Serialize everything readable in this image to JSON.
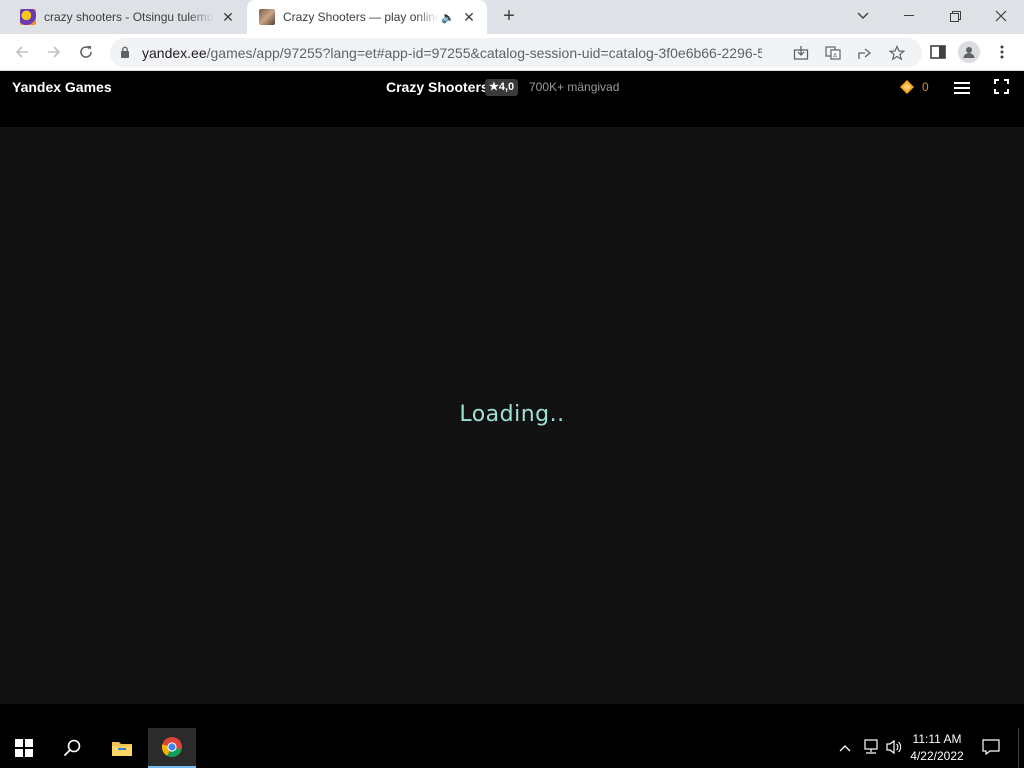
{
  "browser": {
    "tabs": [
      {
        "title": "crazy shooters - Otsingu tulemused"
      },
      {
        "title": "Crazy Shooters — play online"
      }
    ],
    "url_host": "yandex.ee",
    "url_rest": "/games/app/97255?lang=et#app-id=97255&catalog-session-uid=catalog-3f0e6b66-2296-5..."
  },
  "header": {
    "brand": "Yandex Games",
    "game_title": "Crazy Shooters",
    "rating": "★4,0",
    "players": "700K+ mängivad",
    "coins": "0"
  },
  "game": {
    "loading_text": "Loading.."
  },
  "taskbar": {
    "time": "11:11 AM",
    "date": "4/22/2022"
  },
  "colors": {
    "loading_text": "#9ee0d4",
    "coin": "#f5a623",
    "tab_strip": "#dee1e6"
  }
}
